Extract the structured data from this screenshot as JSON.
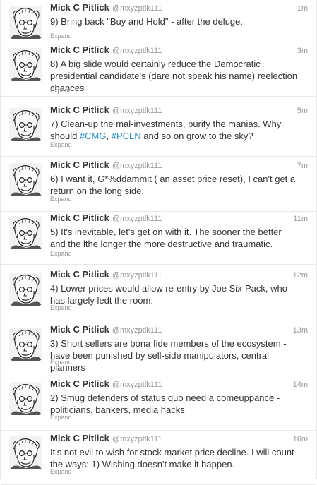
{
  "tweets": [
    {
      "name": "Mick C Pitlick",
      "handle": "@mxyzptlk111",
      "time": "1m",
      "text_parts": [
        {
          "t": "9) Bring back \"Buy and Hold\" - after the deluge."
        }
      ],
      "expand": "Expand"
    },
    {
      "name": "Mick C Pitlick",
      "handle": "@mxyzptlk111",
      "time": "3m",
      "text_parts": [
        {
          "t": "8) A big slide would certainly reduce the Democratic presidential candidate's (dare not speak his name) reelection chances"
        }
      ],
      "expand": "Expand"
    },
    {
      "name": "Mick C Pitlick",
      "handle": "@mxyzptlk111",
      "time": "5m",
      "text_parts": [
        {
          "t": "7) Clean-up the mal-investments, purify the manias. Why should "
        },
        {
          "t": "#CMG",
          "tag": true
        },
        {
          "t": ", "
        },
        {
          "t": "#PCLN",
          "tag": true
        },
        {
          "t": " and so on grow to the sky?"
        }
      ],
      "expand": "Expand"
    },
    {
      "name": "Mick C Pitlick",
      "handle": "@mxyzptlk111",
      "time": "7m",
      "text_parts": [
        {
          "t": "6) I want it, G*%ddammit ( an asset price reset), I can't get a return on the long side."
        }
      ],
      "expand": "Expand"
    },
    {
      "name": "Mick C Pitlick",
      "handle": "@mxyzptlk111",
      "time": "11m",
      "text_parts": [
        {
          "t": "5) It's inevitable, let's get on with it. The sooner the better and the lthe longer the more destructive and traumatic."
        }
      ],
      "expand": "Expand"
    },
    {
      "name": "Mick C Pitlick",
      "handle": "@mxyzptlk111",
      "time": "12m",
      "text_parts": [
        {
          "t": "4) Lower prices would allow re-entry by Joe Six-Pack, who has largely ledt the room."
        }
      ],
      "expand": "Expand"
    },
    {
      "name": "Mick C Pitlick",
      "handle": "@mxyzptlk111",
      "time": "13m",
      "text_parts": [
        {
          "t": "3) Short sellers are bona fide members of the ecosystem - have been punished by sell-side manipulators, central planners"
        }
      ],
      "expand": "Expand"
    },
    {
      "name": "Mick C Pitlick",
      "handle": "@mxyzptlk111",
      "time": "14m",
      "text_parts": [
        {
          "t": "2) Smug defenders of status quo need a comeuppance - politicians, bankers, media hacks"
        }
      ],
      "expand": "Expand"
    },
    {
      "name": "Mick C Pitlick",
      "handle": "@mxyzptlk111",
      "time": "16m",
      "text_parts": [
        {
          "t": "It's not evil to wish for stock market price decline. I will count the ways: 1) Wishing doesn't make it happen."
        }
      ],
      "expand": "Expand"
    }
  ],
  "colors": {
    "hashtag": "#2a92c3",
    "name": "#333333",
    "meta": "#999999"
  }
}
